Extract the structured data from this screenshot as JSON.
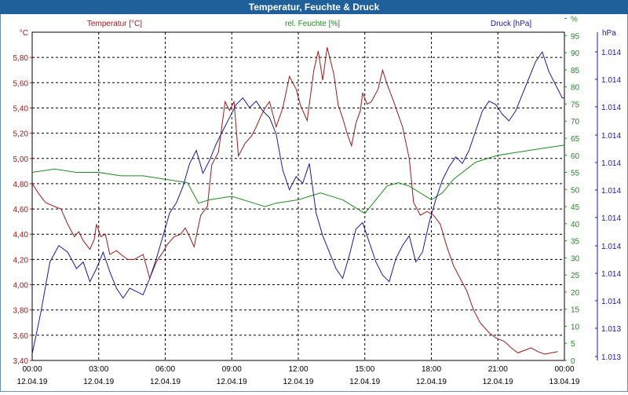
{
  "window": {
    "title": "Temperatur, Feuchte & Druck"
  },
  "chart_data": {
    "type": "line",
    "title": "Temperatur, Feuchte & Druck",
    "grid": true,
    "x_tick_times": [
      "00:00",
      "03:00",
      "06:00",
      "09:00",
      "12:00",
      "15:00",
      "18:00",
      "21:00",
      "00:00"
    ],
    "x_tick_dates": [
      "12.04.19",
      "12.04.19",
      "12.04.19",
      "12.04.19",
      "12.04.19",
      "12.04.19",
      "12.04.19",
      "12.04.19",
      "13.04.19"
    ],
    "x_range_hours": [
      0,
      24
    ],
    "axes": {
      "left": {
        "unit": "°C",
        "range": [
          3.4,
          6.0
        ],
        "ticks": [
          "3,40",
          "3,60",
          "3,80",
          "4,00",
          "4,20",
          "4,40",
          "4,60",
          "4,80",
          "5,00",
          "5,20",
          "5,40",
          "5,60",
          "5,80"
        ],
        "color": "#a01818"
      },
      "middle": {
        "unit": "%",
        "range": [
          0,
          96
        ],
        "ticks": [
          "0",
          "5",
          "10",
          "15",
          "20",
          "25",
          "30",
          "35",
          "40",
          "45",
          "50",
          "55",
          "60",
          "65",
          "70",
          "75",
          "80",
          "85",
          "90",
          "95",
          "%"
        ],
        "color": "#1f8a1f"
      },
      "right": {
        "unit": "hPa",
        "range": [
          0,
          1
        ],
        "ticks": [
          "1.013",
          "1.013",
          "1.014",
          "1.014",
          "1.014",
          "1.014",
          "1.014",
          "1.014",
          "1.014",
          "1.014",
          "1.014",
          "1.014"
        ],
        "color": "#1a1aa0"
      }
    },
    "series": [
      {
        "name": "Temperatur [°C]",
        "axis": "left",
        "color": "#a01818",
        "x": [
          0,
          0.3,
          0.6,
          1,
          1.3,
          1.6,
          1.9,
          2.1,
          2.3,
          2.6,
          2.8,
          2.9,
          3.1,
          3.3,
          3.5,
          3.8,
          4.0,
          4.3,
          4.6,
          5.0,
          5.3,
          5.6,
          5.9,
          6.1,
          6.4,
          6.7,
          6.9,
          7.1,
          7.3,
          7.6,
          7.9,
          8.1,
          8.4,
          8.7,
          8.9,
          9.1,
          9.3,
          9.6,
          9.9,
          10.1,
          10.3,
          10.5,
          10.7,
          11.0,
          11.3,
          11.6,
          11.9,
          12.1,
          12.4,
          12.7,
          12.9,
          13.1,
          13.3,
          13.6,
          13.8,
          14.0,
          14.2,
          14.4,
          14.6,
          14.8,
          14.9,
          15.1,
          15.3,
          15.6,
          15.8,
          16.0,
          16.3,
          16.5,
          16.7,
          17.0,
          17.2,
          17.5,
          17.8,
          18.1,
          18.4,
          18.7,
          19.0,
          19.3,
          19.6,
          19.9,
          20.2,
          20.6,
          20.9,
          21.3,
          21.6,
          21.9,
          22.2,
          22.5,
          22.8,
          23.1,
          23.4,
          23.7
        ],
        "values": [
          4.8,
          4.72,
          4.65,
          4.62,
          4.6,
          4.48,
          4.38,
          4.42,
          4.35,
          4.28,
          4.36,
          4.48,
          4.38,
          4.4,
          4.24,
          4.27,
          4.24,
          4.2,
          4.2,
          4.24,
          4.05,
          4.18,
          4.26,
          4.32,
          4.38,
          4.4,
          4.45,
          4.38,
          4.3,
          4.55,
          4.62,
          4.95,
          5.05,
          5.45,
          5.38,
          5.45,
          5.02,
          5.12,
          5.18,
          5.25,
          5.33,
          5.4,
          5.45,
          5.25,
          5.4,
          5.65,
          5.55,
          5.42,
          5.3,
          5.7,
          5.85,
          5.62,
          5.88,
          5.67,
          5.42,
          5.32,
          5.2,
          5.1,
          5.28,
          5.38,
          5.52,
          5.43,
          5.45,
          5.55,
          5.7,
          5.59,
          5.45,
          5.35,
          5.25,
          5.0,
          4.65,
          4.55,
          4.58,
          4.55,
          4.48,
          4.3,
          4.15,
          4.05,
          3.95,
          3.8,
          3.7,
          3.62,
          3.58,
          3.55,
          3.5,
          3.46,
          3.48,
          3.5,
          3.47,
          3.45,
          3.46,
          3.47
        ]
      },
      {
        "name": "rel. Feuchte [%]",
        "axis": "middle",
        "color": "#1f8a1f",
        "x": [
          0,
          1,
          2,
          3,
          4,
          5,
          6,
          7,
          7.5,
          8,
          9,
          10,
          10.5,
          11,
          12,
          12.5,
          13,
          14,
          15,
          16,
          16.5,
          17,
          18,
          18.5,
          19,
          20,
          21,
          22,
          23,
          24
        ],
        "values": [
          55,
          56,
          55,
          55,
          54,
          54,
          53,
          52,
          46,
          47,
          48,
          46,
          45,
          46,
          47,
          48,
          49,
          47,
          43,
          51,
          52,
          51,
          47,
          49,
          53,
          58,
          60,
          61,
          62,
          63
        ]
      },
      {
        "name": "Druck [hPa]",
        "axis": "right",
        "color": "#1a1aa0",
        "x": [
          0,
          0.4,
          0.8,
          1.2,
          1.6,
          2.0,
          2.3,
          2.6,
          2.9,
          3.2,
          3.5,
          3.8,
          4.1,
          4.4,
          4.7,
          5.0,
          5.3,
          5.6,
          5.9,
          6.2,
          6.5,
          6.8,
          7.1,
          7.4,
          7.7,
          8.0,
          8.3,
          8.6,
          8.9,
          9.2,
          9.5,
          9.8,
          10.1,
          10.4,
          10.7,
          11.0,
          11.3,
          11.6,
          11.9,
          12.2,
          12.5,
          12.8,
          13.1,
          13.4,
          13.7,
          14.0,
          14.3,
          14.6,
          14.9,
          15.2,
          15.5,
          15.8,
          16.1,
          16.4,
          16.7,
          17.0,
          17.3,
          17.6,
          17.9,
          18.2,
          18.5,
          18.8,
          19.1,
          19.4,
          19.7,
          20.0,
          20.3,
          20.6,
          20.9,
          21.2,
          21.5,
          21.8,
          22.1,
          22.4,
          22.7,
          23.0,
          23.3,
          23.6,
          23.9,
          24
        ],
        "values": [
          0.02,
          0.15,
          0.3,
          0.35,
          0.33,
          0.28,
          0.3,
          0.24,
          0.28,
          0.33,
          0.27,
          0.22,
          0.19,
          0.22,
          0.21,
          0.2,
          0.25,
          0.31,
          0.38,
          0.45,
          0.48,
          0.53,
          0.6,
          0.64,
          0.57,
          0.61,
          0.66,
          0.7,
          0.74,
          0.78,
          0.8,
          0.77,
          0.79,
          0.76,
          0.74,
          0.69,
          0.58,
          0.52,
          0.56,
          0.54,
          0.6,
          0.45,
          0.38,
          0.33,
          0.28,
          0.25,
          0.32,
          0.4,
          0.42,
          0.36,
          0.3,
          0.26,
          0.24,
          0.31,
          0.35,
          0.38,
          0.3,
          0.33,
          0.42,
          0.49,
          0.55,
          0.59,
          0.62,
          0.6,
          0.64,
          0.7,
          0.76,
          0.79,
          0.78,
          0.75,
          0.73,
          0.76,
          0.81,
          0.86,
          0.91,
          0.94,
          0.88,
          0.84,
          0.8,
          0.8
        ]
      }
    ]
  }
}
